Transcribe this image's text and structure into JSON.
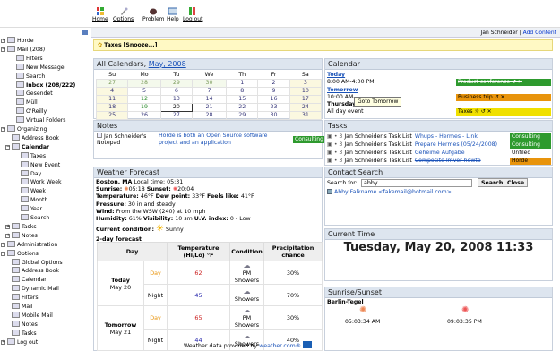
{
  "toolbar": {
    "items": [
      {
        "label": "Home",
        "icon": "home-icon"
      },
      {
        "label": "Options",
        "icon": "options-icon"
      },
      {
        "label": "Problem",
        "icon": "problem-icon"
      },
      {
        "label": "Help",
        "icon": "help-icon"
      },
      {
        "label": "Log out",
        "icon": "logout-icon"
      }
    ]
  },
  "userbar": {
    "user": "Jan Schneider",
    "sep": " | ",
    "add_content": "Add Content"
  },
  "sidebar": {
    "items": [
      {
        "label": "Horde",
        "bold": false
      },
      {
        "label": "Mail (208)",
        "bold": false
      },
      {
        "label": "Filters",
        "bold": false
      },
      {
        "label": "New Message",
        "bold": false
      },
      {
        "label": "Search",
        "bold": false
      },
      {
        "label": "Inbox (208/222)",
        "bold": true
      },
      {
        "label": "Gesendet",
        "bold": false
      },
      {
        "label": "Müll",
        "bold": false
      },
      {
        "label": "O'Reilly",
        "bold": false
      },
      {
        "label": "Virtual Folders",
        "bold": false
      },
      {
        "label": "Organizing",
        "bold": false
      },
      {
        "label": "Address Book",
        "bold": false
      },
      {
        "label": "Calendar",
        "bold": true
      },
      {
        "label": "Taxes",
        "bold": false
      },
      {
        "label": "New Event",
        "bold": false
      },
      {
        "label": "Day",
        "bold": false
      },
      {
        "label": "Work Week",
        "bold": false
      },
      {
        "label": "Week",
        "bold": false
      },
      {
        "label": "Month",
        "bold": false
      },
      {
        "label": "Year",
        "bold": false
      },
      {
        "label": "Search",
        "bold": false
      },
      {
        "label": "Tasks",
        "bold": false
      },
      {
        "label": "Notes",
        "bold": false
      },
      {
        "label": "Administration",
        "bold": false
      },
      {
        "label": "Options",
        "bold": false
      },
      {
        "label": "Global Options",
        "bold": false
      },
      {
        "label": "Address Book",
        "bold": false
      },
      {
        "label": "Calendar",
        "bold": false
      },
      {
        "label": "Dynamic Mail",
        "bold": false
      },
      {
        "label": "Filters",
        "bold": false
      },
      {
        "label": "Mail",
        "bold": false
      },
      {
        "label": "Mobile Mail",
        "bold": false
      },
      {
        "label": "Notes",
        "bold": false
      },
      {
        "label": "Tasks",
        "bold": false
      },
      {
        "label": "Log out",
        "bold": false
      }
    ]
  },
  "notice": {
    "label": "Taxes",
    "link": "[Snooze...]"
  },
  "all_calendars": {
    "title": "All Calendars,",
    "month": "May, 2008",
    "weekdays": [
      "Su",
      "Mo",
      "Tu",
      "We",
      "Th",
      "Fr",
      "Sa"
    ],
    "weeks": [
      [
        "27",
        "28",
        "29",
        "30",
        "1",
        "2",
        "3"
      ],
      [
        "4",
        "5",
        "6",
        "7",
        "8",
        "9",
        "10"
      ],
      [
        "11",
        "12",
        "13",
        "14",
        "15",
        "16",
        "17"
      ],
      [
        "18",
        "19",
        "20",
        "21",
        "22",
        "23",
        "24"
      ],
      [
        "25",
        "26",
        "27",
        "28",
        "29",
        "30",
        "31"
      ]
    ]
  },
  "notes": {
    "title": "Notes",
    "owner": "Jan Schneider's Notepad",
    "text": "Horde is both an Open Source software project and an application",
    "category": "Consulting"
  },
  "weather": {
    "title": "Weather Forecast",
    "location": "Boston, MA",
    "local_time_label": "Local time:",
    "local_time": "05:31",
    "sunrise_label": "Sunrise:",
    "sunrise": "05:18",
    "sunset_label": "Sunset:",
    "sunset": "20:04",
    "temp_label": "Temperature:",
    "temp": "46°F",
    "dew_label": "Dew point:",
    "dew": "33°F",
    "feels_label": "Feels like:",
    "feels": "41°F",
    "pressure_label": "Pressure:",
    "pressure": "30 in and steady",
    "wind_label": "Wind:",
    "wind": "From the WSW (240) at 10 mph",
    "humidity_label": "Humidity:",
    "humidity": "61%",
    "visibility_label": "Visibility:",
    "visibility": "10 sm",
    "uv_label": "U.V. index:",
    "uv": "0 - Low",
    "condition_label": "Current condition:",
    "condition": "Sunny",
    "forecast_title": "2-day forecast",
    "headers": [
      "Day",
      "Temperature (Hi/Lo) °F",
      "Condition",
      "Precipitation chance"
    ],
    "days": [
      {
        "name": "Today",
        "date": "May 20",
        "rows": [
          {
            "part": "Day",
            "temp": "62",
            "cond": "PM Showers",
            "precip": "30%"
          },
          {
            "part": "Night",
            "temp": "45",
            "cond": "Showers",
            "precip": "70%"
          }
        ]
      },
      {
        "name": "Tomorrow",
        "date": "May 21",
        "rows": [
          {
            "part": "Day",
            "temp": "65",
            "cond": "PM Showers",
            "precip": "30%"
          },
          {
            "part": "Night",
            "temp": "44",
            "cond": "Showers",
            "precip": "40%"
          }
        ]
      }
    ],
    "provided": "Weather data provided by",
    "provider": "weather.com®"
  },
  "calendar_panel": {
    "title": "Calendar",
    "today": "Today",
    "tomorrow": "Tomorrow",
    "thursday": "Thursday",
    "e1_time": "8:00 AM-4:00 PM",
    "e1_title": "Product conference ↺ ✕",
    "e2_time": "10:00 AM-",
    "e2_title": "Business trip ↺ ✕",
    "e3_time": "All day event",
    "e3_title": "Taxes ☼ ↺ ✕",
    "tooltip": "Goto Tomorrow"
  },
  "tasks": {
    "title": "Tasks",
    "items": [
      {
        "owner": "Jan Schneider's Task List",
        "title": "Whups - Hermes - Link",
        "cat": "Consulting"
      },
      {
        "owner": "Jan Schneider's Task List",
        "title": "Prepare Hermes (05/24/2008)",
        "cat": "Consulting"
      },
      {
        "owner": "Jan Schneider's Task List",
        "title": "Geheime Aufgabe",
        "cat": "Unfiled"
      },
      {
        "owner": "Jan Schneider's Task List",
        "title": "Composite Imvor howto",
        "cat": "Horde"
      }
    ]
  },
  "contact_search": {
    "title": "Contact Search",
    "label": "Search for:",
    "value": "abby",
    "search_btn": "Search",
    "close_btn": "Close",
    "result": "Abby Falkname <fakemail@hotmail.com>"
  },
  "current_time": {
    "title": "Current Time",
    "value": "Tuesday, May 20, 2008 11:33"
  },
  "sun": {
    "title": "Sunrise/Sunset",
    "place": "Berlin-Tegel",
    "rise": "05:03:34 AM",
    "set": "09:03:35 PM"
  },
  "colors": {
    "consulting": "#2e9a2e",
    "horde": "#e8940c",
    "business": "#e8940c",
    "taxes": "#f0e000",
    "product": "#2e9a2e"
  }
}
